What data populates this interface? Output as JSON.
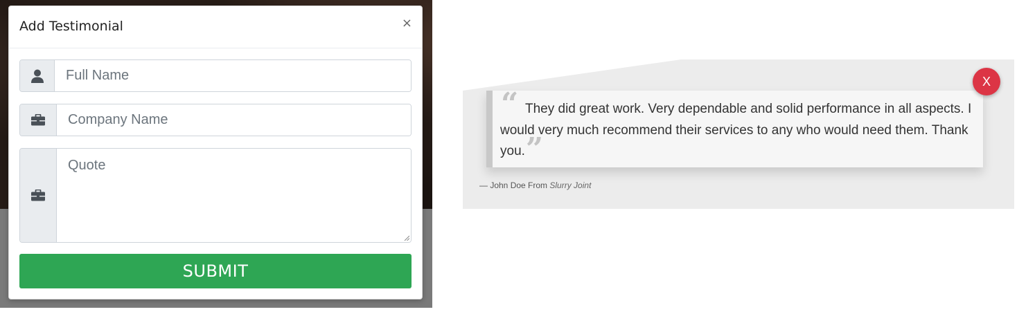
{
  "modal": {
    "title": "Add Testimonial",
    "close_glyph": "×",
    "fields": {
      "full_name": {
        "placeholder": "Full Name",
        "icon": "user-icon"
      },
      "company_name": {
        "placeholder": "Company Name",
        "icon": "briefcase-icon"
      },
      "quote": {
        "placeholder": "Quote",
        "icon": "briefcase-icon"
      }
    },
    "submit_label": "SUBMIT",
    "submit_color": "#2ea654"
  },
  "testimonial": {
    "text": "They did great work. Very dependable and solid performance in all aspects. I would very much recommend their services to any who would need them. Thank you.",
    "open_quote": "“",
    "close_quote": "”",
    "close_button_label": "X",
    "close_button_color": "#dc3545",
    "attribution_prefix": "— John Doe From",
    "company": "Slurry Joint"
  }
}
